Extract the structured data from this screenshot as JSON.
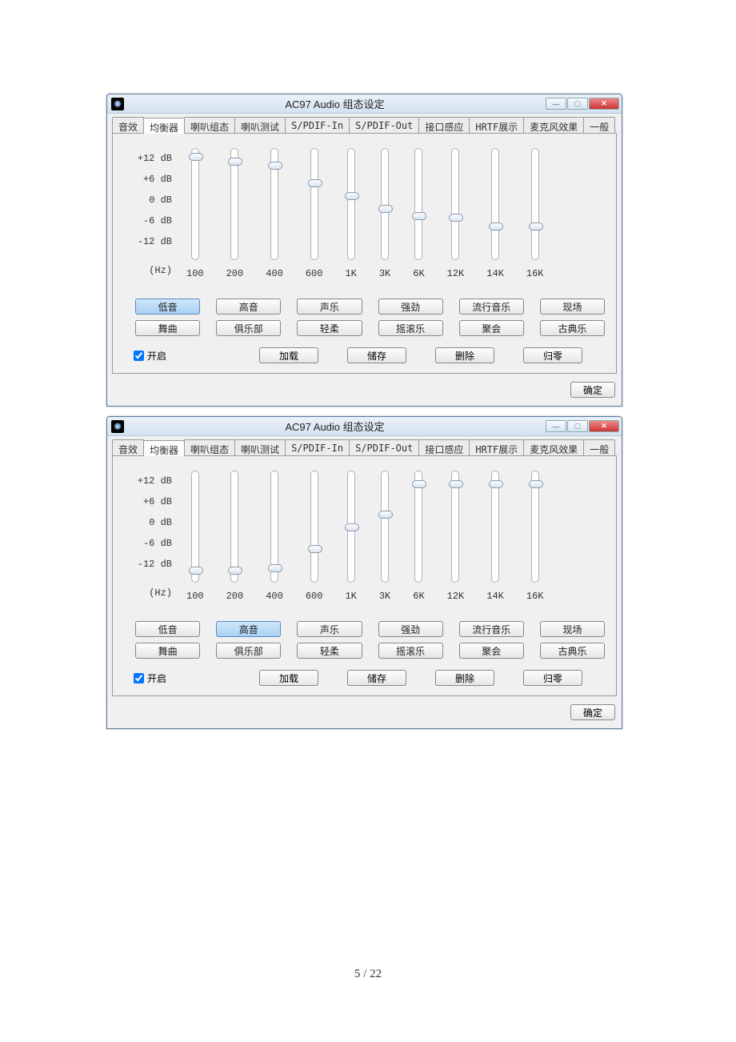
{
  "page_number": "5 / 22",
  "window_title": "AC97 Audio 组态设定",
  "tabs": [
    "音效",
    "均衡器",
    "喇叭组态",
    "喇叭测试",
    "S/PDIF-In",
    "S/PDIF-Out",
    "接口感应",
    "HRTF展示",
    "麦克风效果",
    "一般"
  ],
  "active_tab_index": 1,
  "eq": {
    "db_labels": [
      "+12 dB",
      "+6 dB",
      "0 dB",
      "-6 dB",
      "-12 dB"
    ],
    "hz_label": "(Hz)",
    "freqs": [
      "100",
      "200",
      "400",
      "600",
      "1K",
      "3K",
      "6K",
      "12K",
      "14K",
      "16K"
    ],
    "presets_row1": [
      "低音",
      "高音",
      "声乐",
      "强劲",
      "流行音乐",
      "现场"
    ],
    "presets_row2": [
      "舞曲",
      "俱乐部",
      "轻柔",
      "摇滚乐",
      "聚会",
      "古典乐"
    ],
    "enable_label": "开启",
    "actions": [
      "加载",
      "储存",
      "删除",
      "归零"
    ],
    "ok_label": "确定"
  },
  "window1": {
    "slider_values_db": [
      11,
      10,
      9,
      5,
      2,
      -1,
      -2.5,
      -3,
      -5,
      -5
    ],
    "selected_preset": "低音"
  },
  "window2": {
    "slider_values_db": [
      -10,
      -10,
      -9.5,
      -5,
      0,
      3,
      10,
      10,
      10,
      10
    ],
    "selected_preset": "高音"
  }
}
